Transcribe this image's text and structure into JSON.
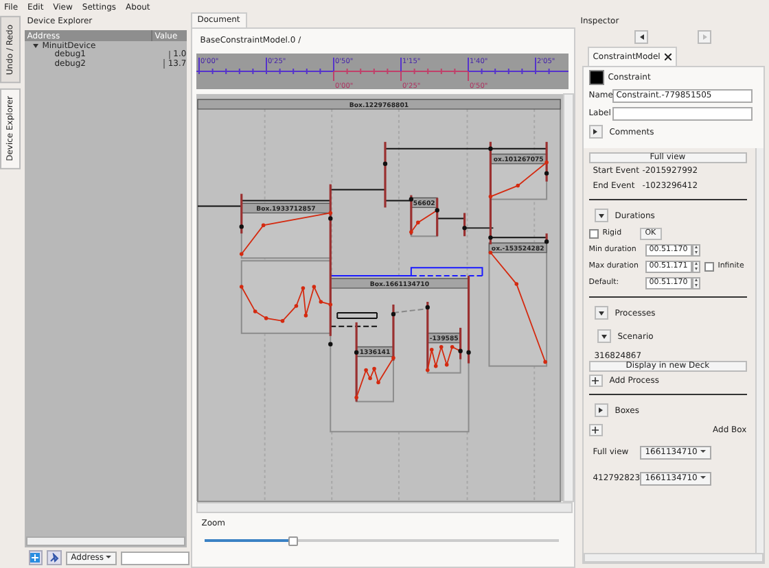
{
  "menu": [
    "File",
    "Edit",
    "View",
    "Settings",
    "About"
  ],
  "side_tabs": [
    {
      "label": "Undo / Redo",
      "selected": false
    },
    {
      "label": "Device Explorer",
      "selected": true
    }
  ],
  "device_explorer": {
    "title": "Device Explorer",
    "columns": [
      "Address",
      "Value"
    ],
    "tree": [
      {
        "name": "MinuitDevice",
        "expanded": true,
        "children": [
          {
            "name": "debug1",
            "value": "1.0"
          },
          {
            "name": "debug2",
            "value": "13.7"
          }
        ]
      }
    ],
    "address_combo": "Address"
  },
  "document": {
    "tab": "Document",
    "breadcrumb": "BaseConstraintModel.0 /",
    "ruler": {
      "ticks": [
        "0'00\"",
        "0'25\"",
        "0'50\"",
        "1'15\"",
        "1'40\"",
        "2'05\""
      ],
      "sub_ticks": [
        "0'00\"",
        "0'25\"",
        "0'50\""
      ]
    },
    "boxes": [
      "Box.1229768801",
      "Box.1933712857",
      "56602",
      "ox.101267075",
      "ox.-153524282",
      "Box.1661134710",
      "1336141",
      "-139585"
    ],
    "zoom": {
      "label": "Zoom",
      "level": 0.25
    }
  },
  "inspector": {
    "title": "Inspector",
    "tab": "ConstraintModel",
    "type": "Constraint",
    "name_label": "Name",
    "name_value": "Constraint.-779851505",
    "label_label": "Label",
    "comments": {
      "label": "Comments",
      "expanded": false
    },
    "full_view_button": "Full view",
    "events": [
      {
        "label": "Start Event",
        "value": "-2015927992"
      },
      {
        "label": "End Event",
        "value": "-1023296412"
      }
    ],
    "durations": {
      "label": "Durations",
      "expanded": true,
      "rigid": {
        "label": "Rigid",
        "checked": false
      },
      "ok": "OK",
      "rows": [
        {
          "label": "Min duration",
          "value": "00.51.170"
        },
        {
          "label": "Max duration",
          "value": "00.51.171",
          "infinite": {
            "label": "Infinite",
            "checked": false
          }
        },
        {
          "label": "Default:",
          "value": "00.51.170"
        }
      ]
    },
    "processes": {
      "label": "Processes",
      "expanded": true,
      "items": [
        {
          "label": "Scenario",
          "expanded": true,
          "id": "316824867",
          "button": "Display in new Deck"
        }
      ],
      "add": "Add Process"
    },
    "boxes": {
      "label": "Boxes",
      "expanded": false,
      "add": "Add Box",
      "views": [
        {
          "label": "Full view",
          "value": "1661134710"
        },
        {
          "label": "412792823",
          "value": "1661134710"
        }
      ]
    }
  }
}
